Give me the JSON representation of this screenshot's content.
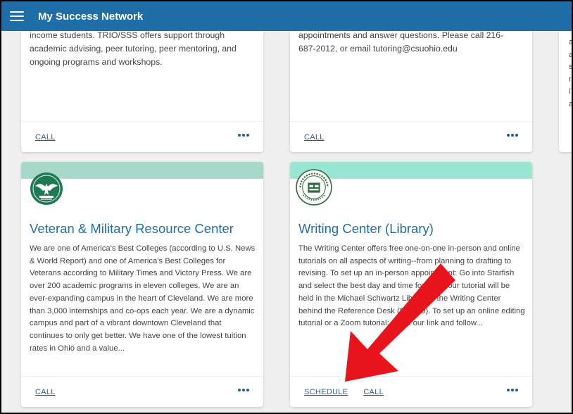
{
  "app": {
    "title": "My Success Network"
  },
  "cards": [
    {
      "id": "trio",
      "top_lines": [
        "income students. TRIO/SSS offers support through",
        "academic advising, peer tutoring, peer mentoring, and",
        "ongoing programs and workshops."
      ],
      "footer": [
        "CALL"
      ]
    },
    {
      "id": "tutoring",
      "top_lines": [
        "appointments and answer questions. Please call 216-",
        "687-2012, or email tutoring@csuohio.edu"
      ],
      "footer": [
        "CALL"
      ]
    },
    {
      "id": "veteran",
      "band_color": "#a8d8c9",
      "title": "Veteran & Military Resource Center",
      "body": "We are one of America's Best Colleges (according to U.S. News & World Report) and one of America's Best Colleges for Veterans according to Military Times and Victory Press. We are over 200 academic programs in eleven colleges. We are an ever-expanding campus in the heart of Cleveland. We are more than 3,000 internships and co-ops each year. We are a dynamic campus and part of a vibrant downtown Cleveland that continues to only get better. We have one of the lowest tuition rates in Ohio and a value...",
      "footer": [
        "CALL"
      ]
    },
    {
      "id": "writing",
      "band_color": "#9ae6d2",
      "title": "Writing Center (Library)",
      "body": "The Writing Center offers free one-on-one in-person and online tutorials on all aspects of writing--from planning to drafting to revising. To set up an in-person appointment: Go into Starfish and select the best day and time for you; your tutorial will be held in the Michael Schwartz Library in the Writing Center behind the Reference Desk (RT 200). To set up an online editing tutorial or a Zoom tutorial: Go to our link and follow...",
      "footer": [
        "SCHEDULE",
        "CALL"
      ]
    }
  ],
  "partial_card": {
    "letters": [
      "a",
      "a",
      "s",
      "r",
      "i",
      "a"
    ]
  },
  "colors": {
    "header": "#1f6ea8",
    "link": "#1f5f99",
    "arrow": "#e8141b"
  }
}
